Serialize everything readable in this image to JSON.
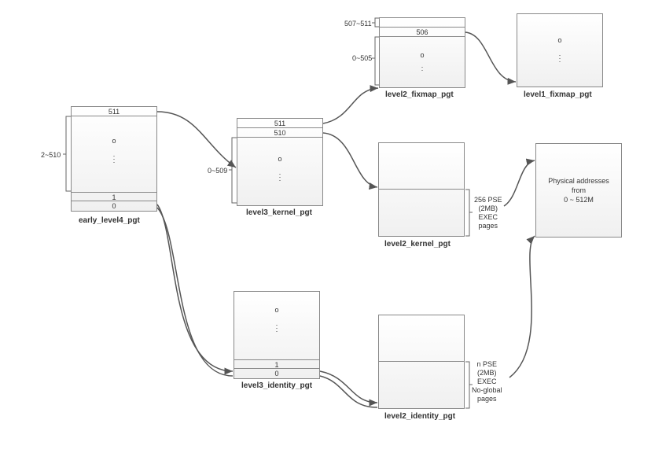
{
  "diagram": {
    "tables": {
      "early_level4_pgt": {
        "caption": "early_level4_pgt",
        "range_label": "2~510",
        "rows_top": [
          "511"
        ],
        "rows_bottom": [
          "1",
          "0"
        ],
        "body_symbol": "o"
      },
      "level3_kernel_pgt": {
        "caption": "level3_kernel_pgt",
        "range_label": "0~509",
        "rows_top": [
          "511",
          "510"
        ],
        "body_symbol": "o"
      },
      "level3_identity_pgt": {
        "caption": "level3_identity_pgt",
        "rows_bottom": [
          "1",
          "0"
        ],
        "body_symbol": "o"
      },
      "level2_fixmap_pgt": {
        "caption": "level2_fixmap_pgt",
        "range_label_top": "507~511",
        "range_label_bottom": "0~505",
        "rows_top": [
          "",
          "506"
        ],
        "body_symbol": "o"
      },
      "level2_kernel_pgt": {
        "caption": "level2_kernel_pgt",
        "annotation": "256 PSE\n(2MB)\nEXEC\npages"
      },
      "level2_identity_pgt": {
        "caption": "level2_identity_pgt",
        "annotation": "n PSE\n(2MB)\nEXEC\nNo-global\npages"
      },
      "level1_fixmap_pgt": {
        "caption": "level1_fixmap_pgt",
        "body_symbol": "o"
      },
      "physical": {
        "text": "Physical addresses\nfrom\n0 ~ 512M"
      }
    }
  }
}
